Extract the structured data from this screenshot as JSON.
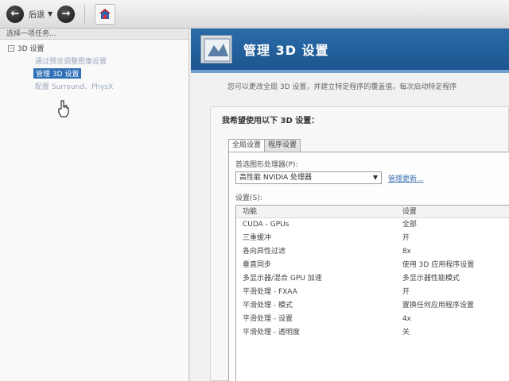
{
  "toolbar": {
    "back_label": "后退",
    "back_icon": "arrow-left-icon",
    "forward_icon": "arrow-right-icon",
    "home_icon": "home-icon"
  },
  "left_pane": {
    "header": "选择一项任务...",
    "root": "3D 设置",
    "items": [
      {
        "label": "通过预览调整图像设置",
        "state": "normal"
      },
      {
        "label": "管理 3D 设置",
        "state": "selected"
      },
      {
        "label": "配置 Surround、PhysX",
        "state": "normal"
      }
    ]
  },
  "main": {
    "title": "管理 3D 设置",
    "description": "您可以更改全局 3D 设置，并建立特定程序的覆盖值。每次启动特定程序",
    "section_heading": "我希望使用以下 3D 设置：",
    "tabs": [
      {
        "label": "全局设置",
        "active": true
      },
      {
        "label": "程序设置",
        "active": false
      }
    ],
    "processor_label": "首选图形处理器(P):",
    "processor_value": "高性能 NVIDIA 处理器",
    "manage_link": "管理更新...",
    "settings_label": "设置(S):",
    "table": {
      "headers": [
        "功能",
        "设置"
      ],
      "rows": [
        [
          "CUDA - GPUs",
          "全部"
        ],
        [
          "三重缓冲",
          "开"
        ],
        [
          "各向异性过滤",
          "8x"
        ],
        [
          "垂直同步",
          "使用 3D 应用程序设置"
        ],
        [
          "多显示器/混合 GPU 加速",
          "多显示器性能模式"
        ],
        [
          "平滑处理 - FXAA",
          "开"
        ],
        [
          "平滑处理 - 模式",
          "置换任何应用程序设置"
        ],
        [
          "平滑处理 - 设置",
          "4x"
        ],
        [
          "平滑处理 - 透明度",
          "关"
        ]
      ]
    }
  },
  "colors": {
    "banner": "#1d5590",
    "selection": "#2f6fb7",
    "link": "#3b72b3"
  }
}
